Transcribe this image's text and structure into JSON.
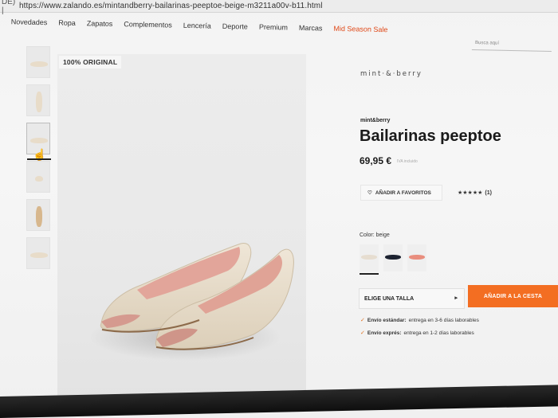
{
  "browser": {
    "url_prefix": "DE) |",
    "url": "https://www.zalando.es/mintandberry-bailarinas-peeptoe-beige-m3211a00v-b11.html"
  },
  "nav": {
    "items": [
      "Novedades",
      "Ropa",
      "Zapatos",
      "Complementos",
      "Lencería",
      "Deporte",
      "Premium",
      "Marcas"
    ],
    "sale_label": "Mid Season Sale",
    "search_placeholder": "Busca aquí"
  },
  "gallery": {
    "badge": "100% ORIGINAL",
    "thumbnails": 6,
    "active_thumbnail": 3
  },
  "product": {
    "brand_logo": "mint·&·berry",
    "brand": "mint&berry",
    "title": "Bailarinas peeptoe",
    "price": "69,95 €",
    "price_note": "IVA incluido",
    "favorite_label": "AÑADIR A FAVORITOS",
    "rating_stars": "★★★★★",
    "rating_count": "(1)",
    "color_label": "Color:",
    "color_value": "beige",
    "swatch_colors": [
      "#e6ddd0",
      "#1c2230",
      "#e98e7e"
    ],
    "size_label": "ELIGE UNA TALLA",
    "size_arrow": "▸",
    "add_to_cart": "AÑADIR A LA CESTA",
    "accent_color": "#f36e22",
    "shipping": [
      {
        "label": "Envío estándar:",
        "text": "entrega en 3-6 días laborables"
      },
      {
        "label": "Envío exprés:",
        "text": "entrega en 1-2 días laborables"
      }
    ]
  }
}
